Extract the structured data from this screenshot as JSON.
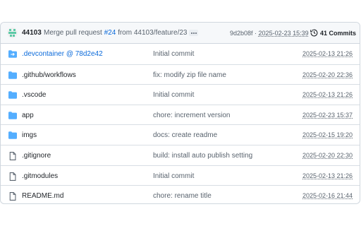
{
  "commit": {
    "author": "44103",
    "message_prefix": "Merge pull request ",
    "pr_ref": "#24",
    "message_suffix": " from 44103/feature/23",
    "sha": "9d2b08f",
    "separator": " · ",
    "date": "2025-02-23 15:39",
    "commit_count": "41 Commits"
  },
  "files": [
    {
      "name": ".devcontainer @ 78d2e42",
      "type": "submodule",
      "message": "Initial commit",
      "date": "2025-02-13 21:26"
    },
    {
      "name": ".github/workflows",
      "type": "folder",
      "message": "fix: modify zip file name",
      "date": "2025-02-20 22:36"
    },
    {
      "name": ".vscode",
      "type": "folder",
      "message": "Initial commit",
      "date": "2025-02-13 21:26"
    },
    {
      "name": "app",
      "type": "folder",
      "message": "chore: increment version",
      "date": "2025-02-23 15:37"
    },
    {
      "name": "imgs",
      "type": "folder",
      "message": "docs: create readme",
      "date": "2025-02-15 19:20"
    },
    {
      "name": ".gitignore",
      "type": "file",
      "message": "build: install auto publish setting",
      "date": "2025-02-20 22:30"
    },
    {
      "name": ".gitmodules",
      "type": "file",
      "message": "Initial commit",
      "date": "2025-02-13 21:26"
    },
    {
      "name": "README.md",
      "type": "file",
      "message": "chore: rename title",
      "date": "2025-02-16 21:44"
    }
  ],
  "colors": {
    "folder": "#54aeff",
    "link": "#0969da",
    "muted": "#59636e"
  }
}
